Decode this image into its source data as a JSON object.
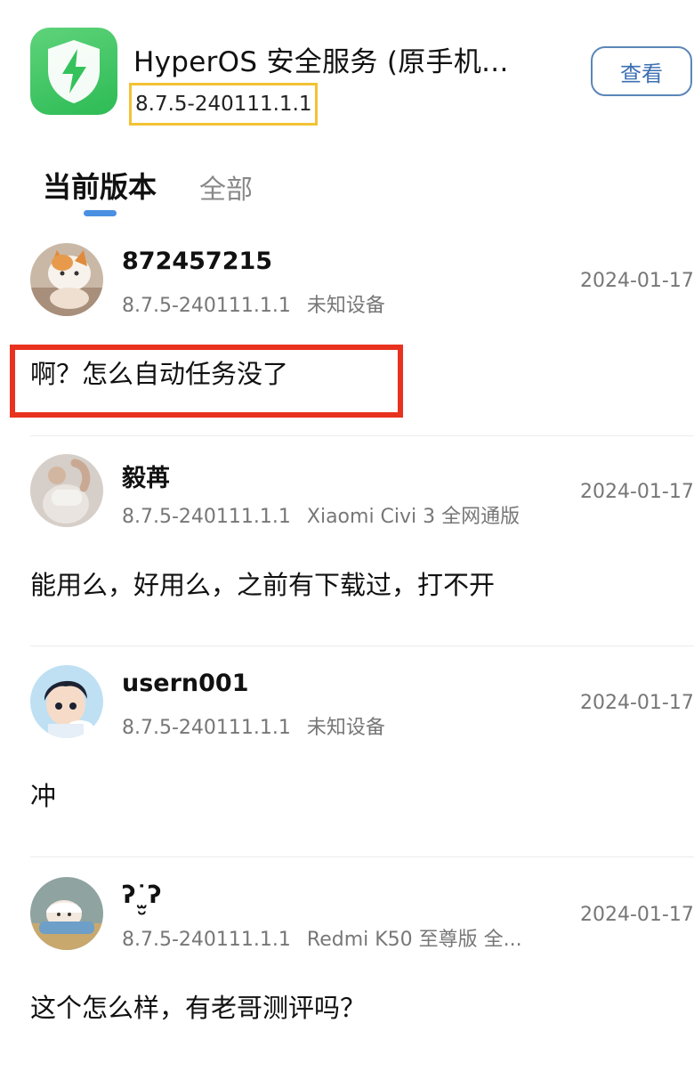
{
  "app": {
    "title": "HyperOS 安全服务 (原手机...",
    "version": "8.7.5-240111.1.1",
    "view_button_label": "查看"
  },
  "tabs": [
    {
      "label": "当前版本",
      "active": true
    },
    {
      "label": "全部",
      "active": false
    }
  ],
  "comments": [
    {
      "username": "872457215",
      "version": "8.7.5-240111.1.1",
      "device": "未知设备",
      "date": "2024-01-17",
      "text": "啊？怎么自动任务没了",
      "avatar": "cat-avatar"
    },
    {
      "username": "毅苒",
      "version": "8.7.5-240111.1.1",
      "device": "Xiaomi Civi 3 全网通版",
      "date": "2024-01-17",
      "text": "能用么，好用么，之前有下载过，打不开",
      "avatar": "person-avatar"
    },
    {
      "username": "usern001",
      "version": "8.7.5-240111.1.1",
      "device": "未知设备",
      "date": "2024-01-17",
      "text": "冲",
      "avatar": "anime-boy-avatar"
    },
    {
      "username": "ʔ˙̫̮ʔ",
      "version": "8.7.5-240111.1.1",
      "device": "Redmi K50 至尊版 全...",
      "date": "2024-01-17",
      "text": "这个怎么样，有老哥测评吗？",
      "avatar": "cartoon-avatar"
    }
  ],
  "colors": {
    "accent": "#4a90e2",
    "app_icon_green": "#2dbb55",
    "highlight_yellow": "#f3c234",
    "highlight_red": "#e8321f"
  }
}
